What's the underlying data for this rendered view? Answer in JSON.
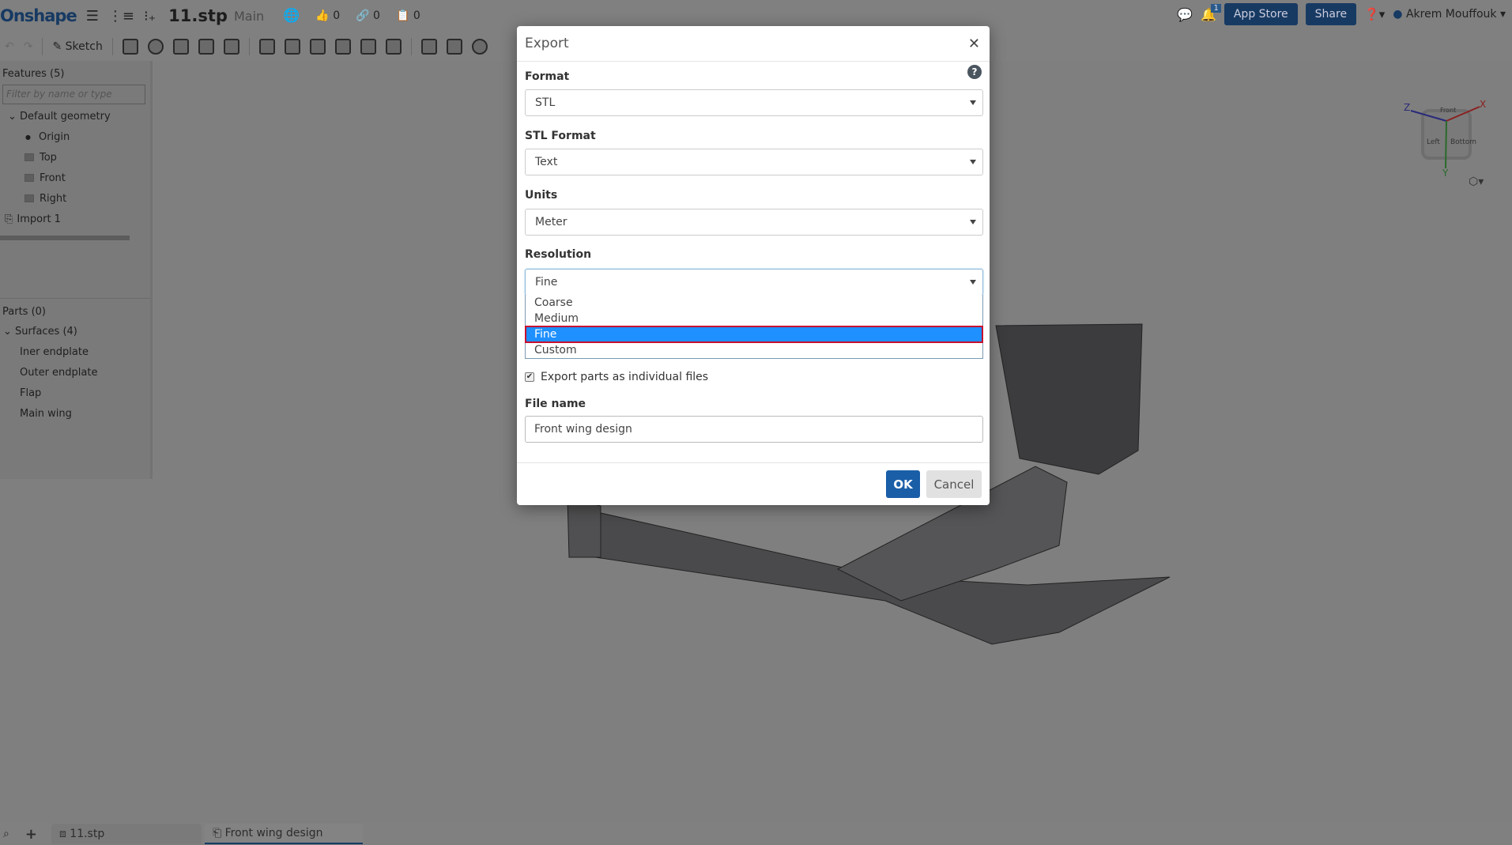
{
  "topbar": {
    "logo": "Onshape",
    "doc_title": "11.stp",
    "branch": "Main",
    "likes": "0",
    "links": "0",
    "copies": "0",
    "notifications": "1",
    "app_store": "App Store",
    "share": "Share",
    "user": "Akrem Mouffouk"
  },
  "toolbar": {
    "sketch": "Sketch"
  },
  "features": {
    "title": "Features (5)",
    "filter_placeholder": "Filter by name or type",
    "default_geometry": "Default geometry",
    "items": [
      "Origin",
      "Top",
      "Front",
      "Right"
    ],
    "import": "Import 1"
  },
  "parts": {
    "title": "Parts (0)",
    "surfaces": "Surfaces (4)",
    "items": [
      "Iner endplate",
      "Outer endplate",
      "Flap",
      "Main wing"
    ]
  },
  "viewcube": {
    "top": "Front",
    "left": "Left",
    "right": "Bottom",
    "x": "X",
    "y": "Y",
    "z": "Z"
  },
  "bottom": {
    "tab1": "11.stp",
    "tab2": "Front wing design"
  },
  "dialog": {
    "title": "Export",
    "format_label": "Format",
    "format_value": "STL",
    "stl_format_label": "STL Format",
    "stl_format_value": "Text",
    "units_label": "Units",
    "units_value": "Meter",
    "resolution_label": "Resolution",
    "resolution_value": "Fine",
    "resolution_options": [
      "Coarse",
      "Medium",
      "Fine",
      "Custom"
    ],
    "export_individual": "Export parts as individual files",
    "export_individual_checked": true,
    "file_name_label": "File name",
    "file_name_value": "Front wing design",
    "ok": "OK",
    "cancel": "Cancel"
  }
}
